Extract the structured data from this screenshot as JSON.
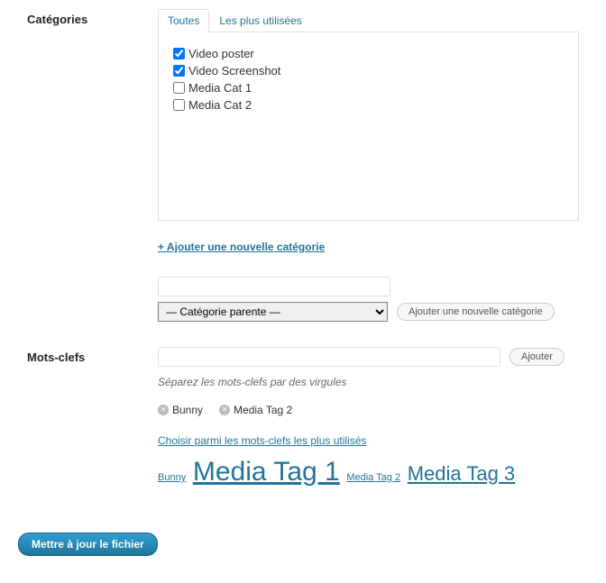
{
  "sections": {
    "categories_label": "Catégories",
    "tags_label": "Mots-clefs"
  },
  "tabs": {
    "all": "Toutes",
    "most_used": "Les plus utilisées"
  },
  "categories": {
    "items": [
      {
        "label": "Video poster",
        "checked": true
      },
      {
        "label": "Video Screenshot",
        "checked": true
      },
      {
        "label": "Media Cat 1",
        "checked": false
      },
      {
        "label": "Media Cat 2",
        "checked": false
      }
    ],
    "add_link": "+ Ajouter une nouvelle catégorie",
    "parent_placeholder": "— Catégorie parente —",
    "add_button": "Ajouter une nouvelle catégorie"
  },
  "tags": {
    "add_button": "Ajouter",
    "hint": "Séparez les mots-clefs par des virgules",
    "assigned": [
      "Bunny",
      "Media Tag 2"
    ],
    "choose_link": "Choisir parmi les mots-clefs les plus utilisés",
    "cloud": [
      {
        "label": "Bunny",
        "size": 11
      },
      {
        "label": "Media Tag 1",
        "size": 30
      },
      {
        "label": "Media Tag 2",
        "size": 11
      },
      {
        "label": "Media Tag 3",
        "size": 22
      }
    ]
  },
  "update_button": "Mettre à jour le fichier"
}
